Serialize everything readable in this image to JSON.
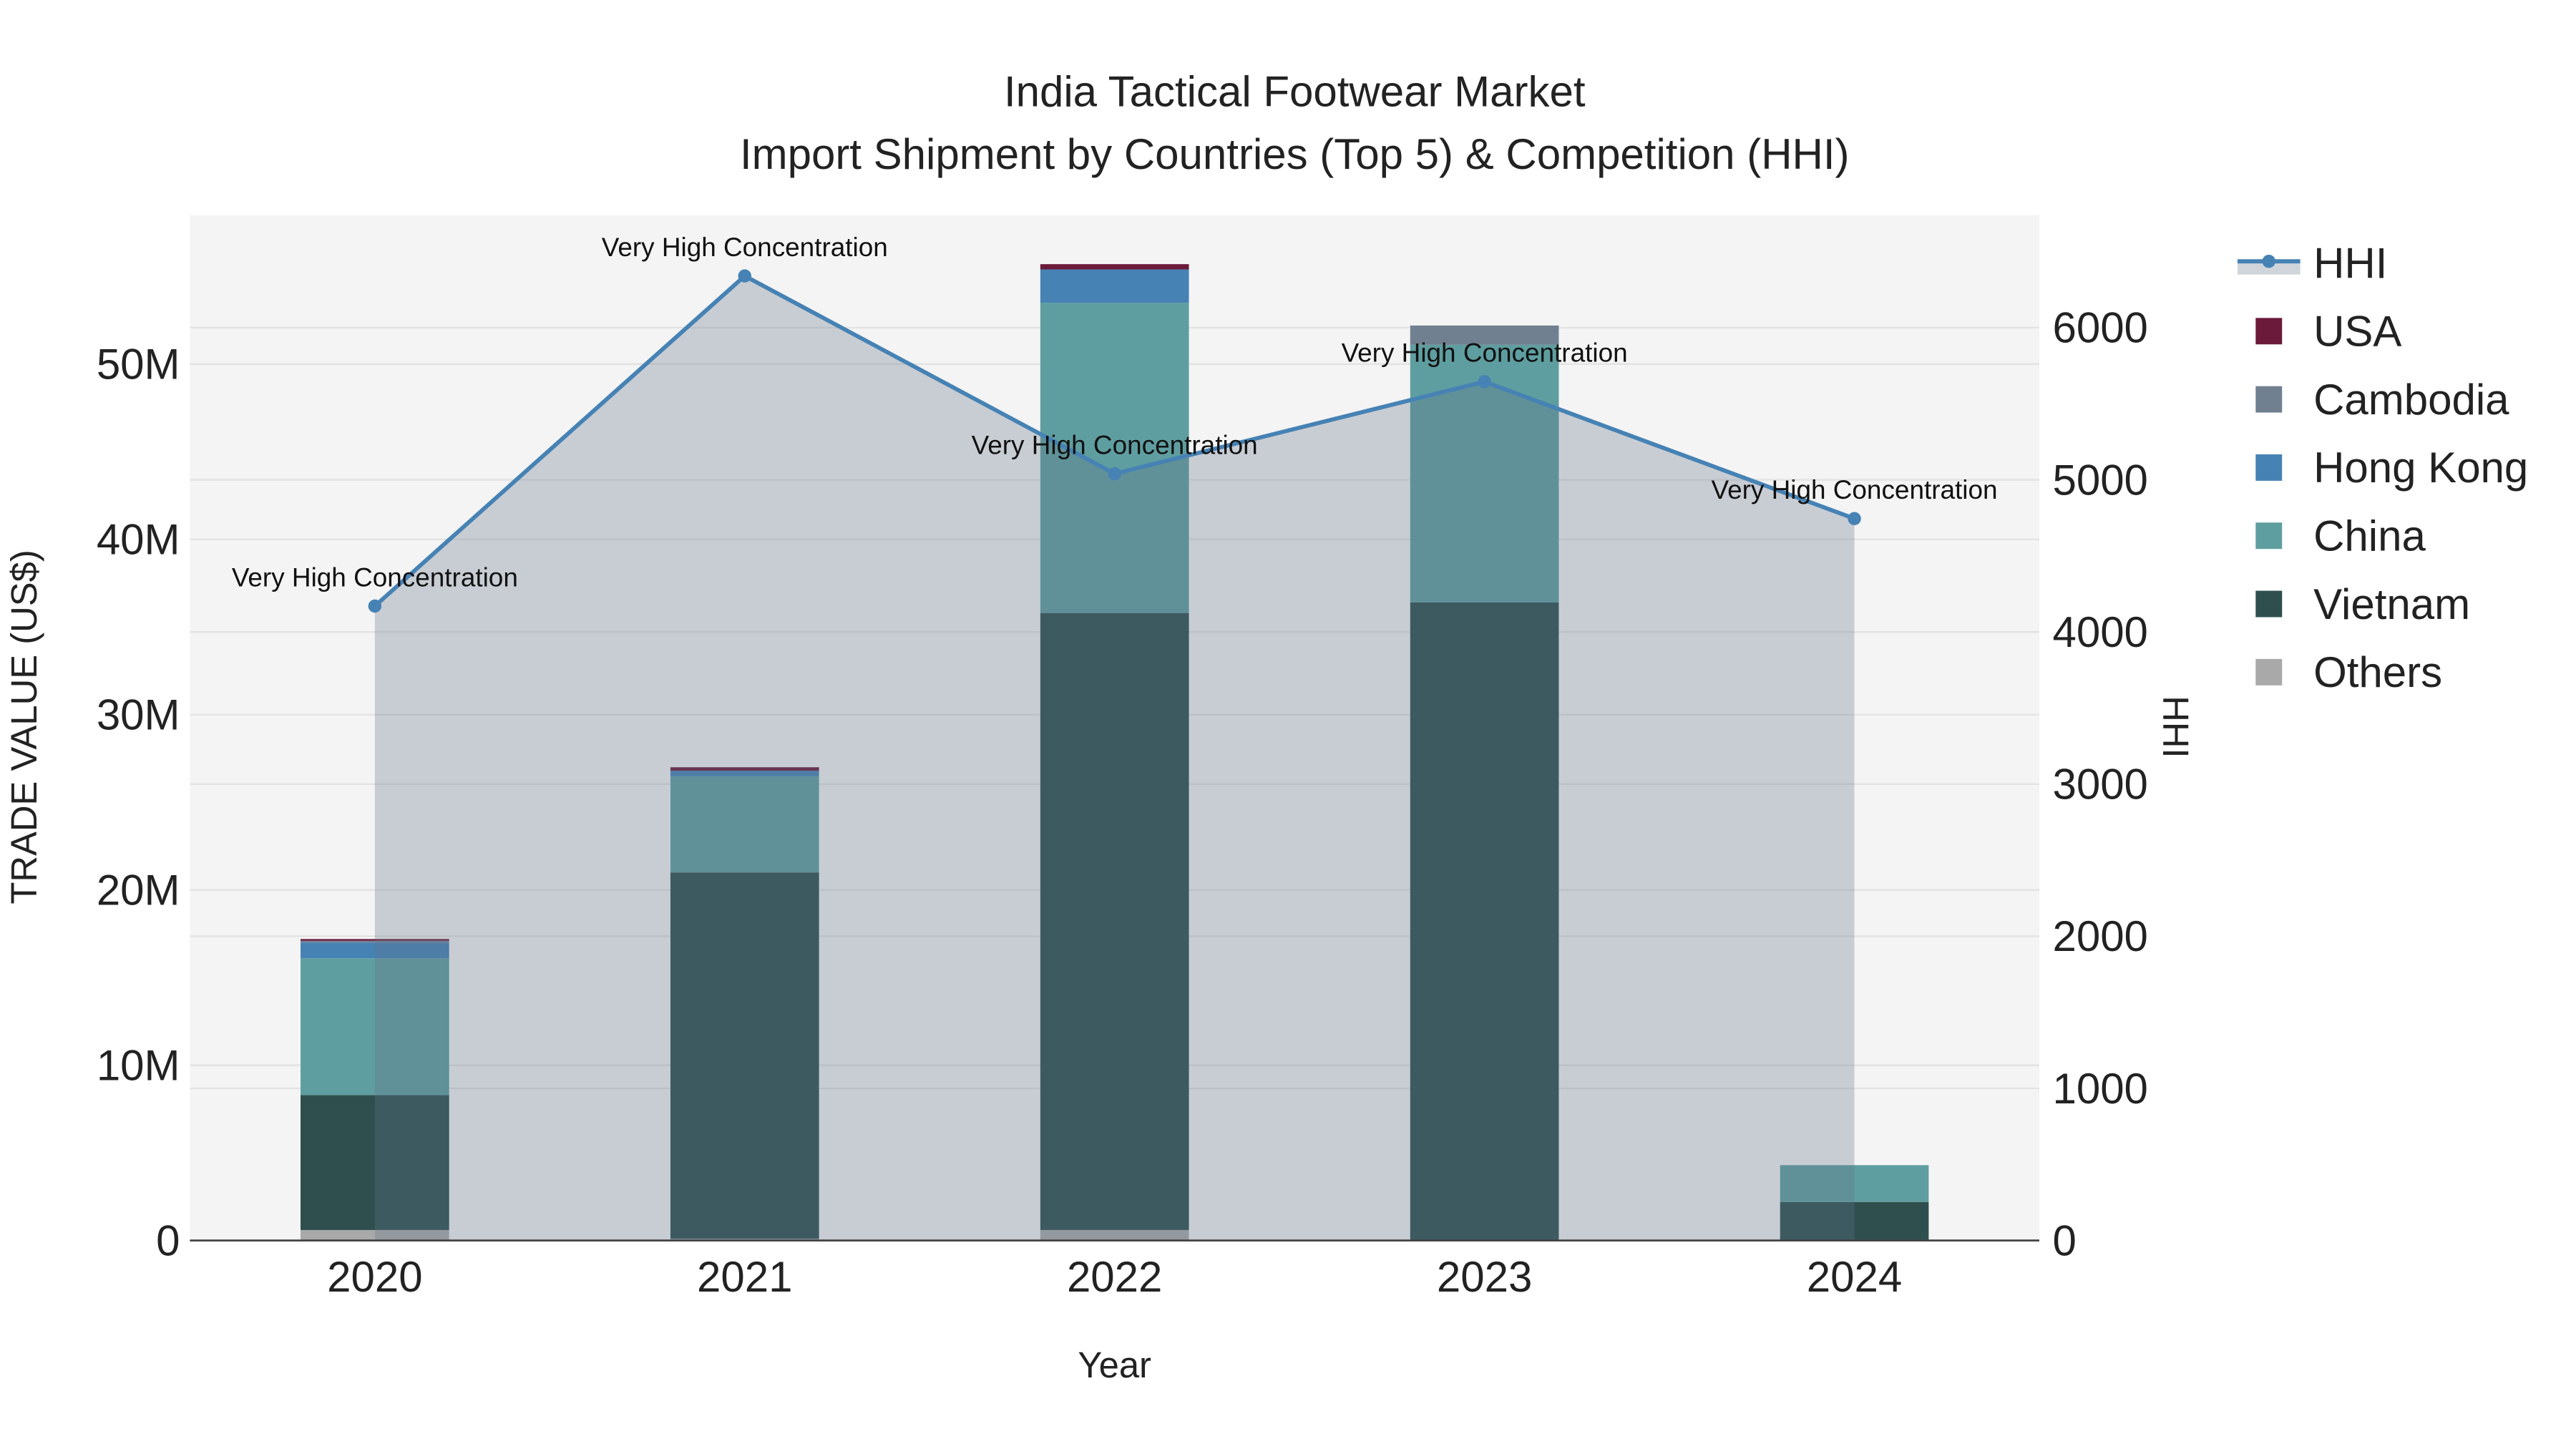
{
  "chart_data": {
    "type": "bar",
    "title": "India Tactical Footwear Market",
    "subtitle": "Import Shipment by Countries (Top 5) & Competition (HHI)",
    "xlabel": "Year",
    "ylabel": "TRADE VALUE (US$)",
    "y2label": "HHI",
    "categories": [
      "2020",
      "2021",
      "2022",
      "2023",
      "2024"
    ],
    "ylim": [
      0,
      58500000
    ],
    "y2lim": [
      0,
      6740
    ],
    "yticks": [
      0,
      10000000,
      20000000,
      30000000,
      40000000,
      50000000
    ],
    "ytick_labels": [
      "0",
      "10M",
      "20M",
      "30M",
      "40M",
      "50M"
    ],
    "y2ticks": [
      0,
      1000,
      2000,
      3000,
      4000,
      5000,
      6000
    ],
    "y2tick_labels": [
      "0",
      "1000",
      "2000",
      "3000",
      "4000",
      "5000",
      "6000"
    ],
    "stack_order": [
      "Others",
      "Vietnam",
      "China",
      "Hong Kong",
      "Cambodia",
      "USA"
    ],
    "series": [
      {
        "name": "Others",
        "color": "#a9a9a9",
        "values": [
          600000,
          100000,
          600000,
          0,
          0
        ]
      },
      {
        "name": "Vietnam",
        "color": "#2f4f4f",
        "values": [
          7700000,
          20900000,
          35200000,
          36400000,
          2200000
        ]
      },
      {
        "name": "China",
        "color": "#5f9ea0",
        "values": [
          7800000,
          5500000,
          17700000,
          14700000,
          2100000
        ]
      },
      {
        "name": "Hong Kong",
        "color": "#4682b4",
        "values": [
          900000,
          300000,
          1900000,
          0,
          0
        ]
      },
      {
        "name": "Cambodia",
        "color": "#708090",
        "values": [
          100000,
          0,
          0,
          1100000,
          0
        ]
      },
      {
        "name": "USA",
        "color": "#6b1a3a",
        "values": [
          100000,
          200000,
          300000,
          0,
          0
        ]
      }
    ],
    "line": {
      "name": "HHI",
      "color": "#4682b4",
      "values": [
        4170,
        6340,
        5040,
        5645,
        4745
      ]
    },
    "annotations": [
      "Very High Concentration",
      "Very High Concentration",
      "Very High Concentration",
      "Very High Concentration",
      "Very High Concentration"
    ],
    "legend_order": [
      "HHI",
      "USA",
      "Cambodia",
      "Hong Kong",
      "China",
      "Vietnam",
      "Others"
    ],
    "legend_position": "right",
    "grid": true
  }
}
